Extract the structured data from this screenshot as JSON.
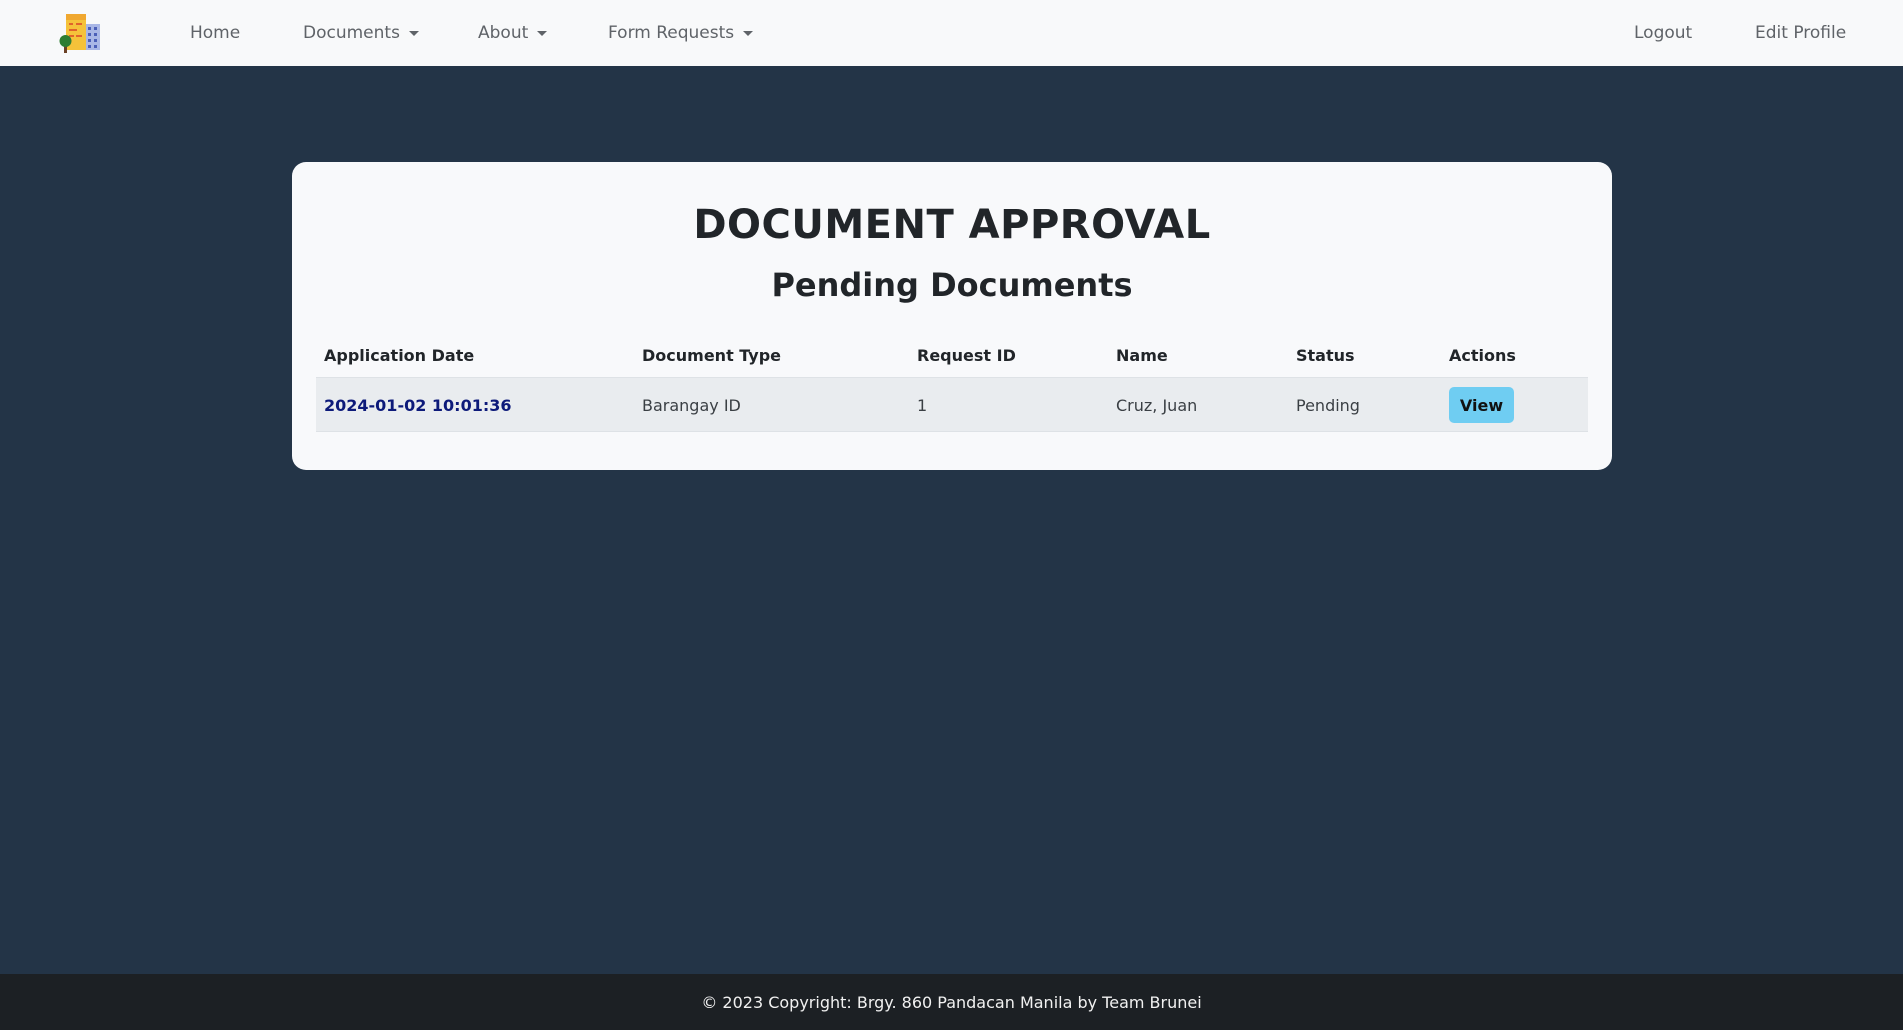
{
  "navbar": {
    "home": "Home",
    "documents": "Documents",
    "about": "About",
    "form_requests": "Form Requests",
    "logout": "Logout",
    "edit_profile": "Edit Profile"
  },
  "main": {
    "title": "DOCUMENT APPROVAL",
    "subtitle": "Pending Documents",
    "table": {
      "headers": [
        "Application Date",
        "Document Type",
        "Request ID",
        "Name",
        "Status",
        "Actions"
      ],
      "rows": [
        {
          "application_date": "2024-01-02 10:01:36",
          "document_type": "Barangay ID",
          "request_id": "1",
          "name": "Cruz, Juan",
          "status": "Pending",
          "action_label": "View"
        }
      ]
    }
  },
  "footer": {
    "text": "© 2023 Copyright: Brgy. 860 Pandacan Manila by Team Brunei"
  },
  "colors": {
    "page_bg": "#233447",
    "card_bg": "#f8f9fb",
    "view_button": "#6fcdf2",
    "date_link": "#0d1a7a"
  },
  "icons": {
    "logo": "barangay-building-logo-icon",
    "dropdown": "caret-down-icon"
  }
}
